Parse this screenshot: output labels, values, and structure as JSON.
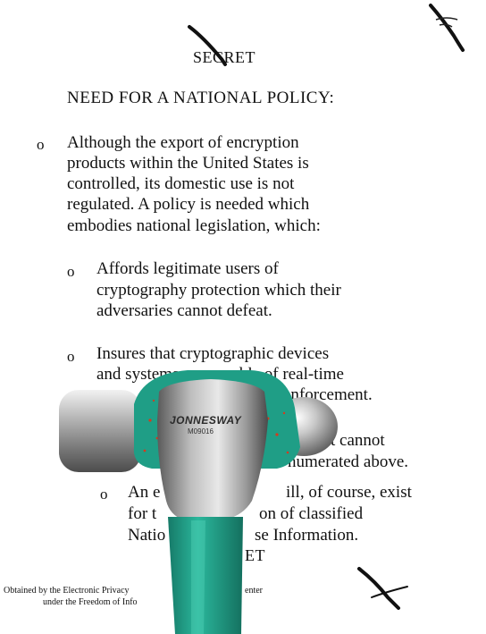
{
  "document": {
    "classification_top": "SECRET",
    "section_title": "NEED FOR A NATIONAL POLICY:",
    "item1": {
      "bullet": "o",
      "lines": [
        "Although the export of encryption",
        "products within the United States is",
        "controlled, its domestic use is not",
        "regulated.  A policy is needed which",
        "embodies national legislation, which:"
      ]
    },
    "sub1": {
      "bullet": "o",
      "lines": [
        "Affords legitimate users of",
        "cryptography protection which their",
        "adversaries cannot defeat."
      ]
    },
    "sub2": {
      "bullet": "o",
      "lines": [
        "Insures that cryptographic devices",
        "and systems are capable of real-time",
        "enforcement."
      ]
    },
    "sub3": {
      "lines": [
        "t cannot",
        "numerated above."
      ]
    },
    "sub4": {
      "bullet": "o",
      "lines": [
        "An e",
        "ill, of course, exist",
        "for t",
        "on of classified",
        "Natio",
        "se Information."
      ]
    },
    "classification_bottom": "ET",
    "footer": {
      "line1_left": "Obtained by the Electronic Privacy",
      "line1_right": "enter",
      "line2": "under the Freedom of Info"
    },
    "hammer": {
      "brand": "JONNESWAY",
      "model": "M09016"
    },
    "colors": {
      "hammer_green": "#1f9e86",
      "hammer_red_flecks": "#d63a1e",
      "ink": "#111111"
    }
  }
}
